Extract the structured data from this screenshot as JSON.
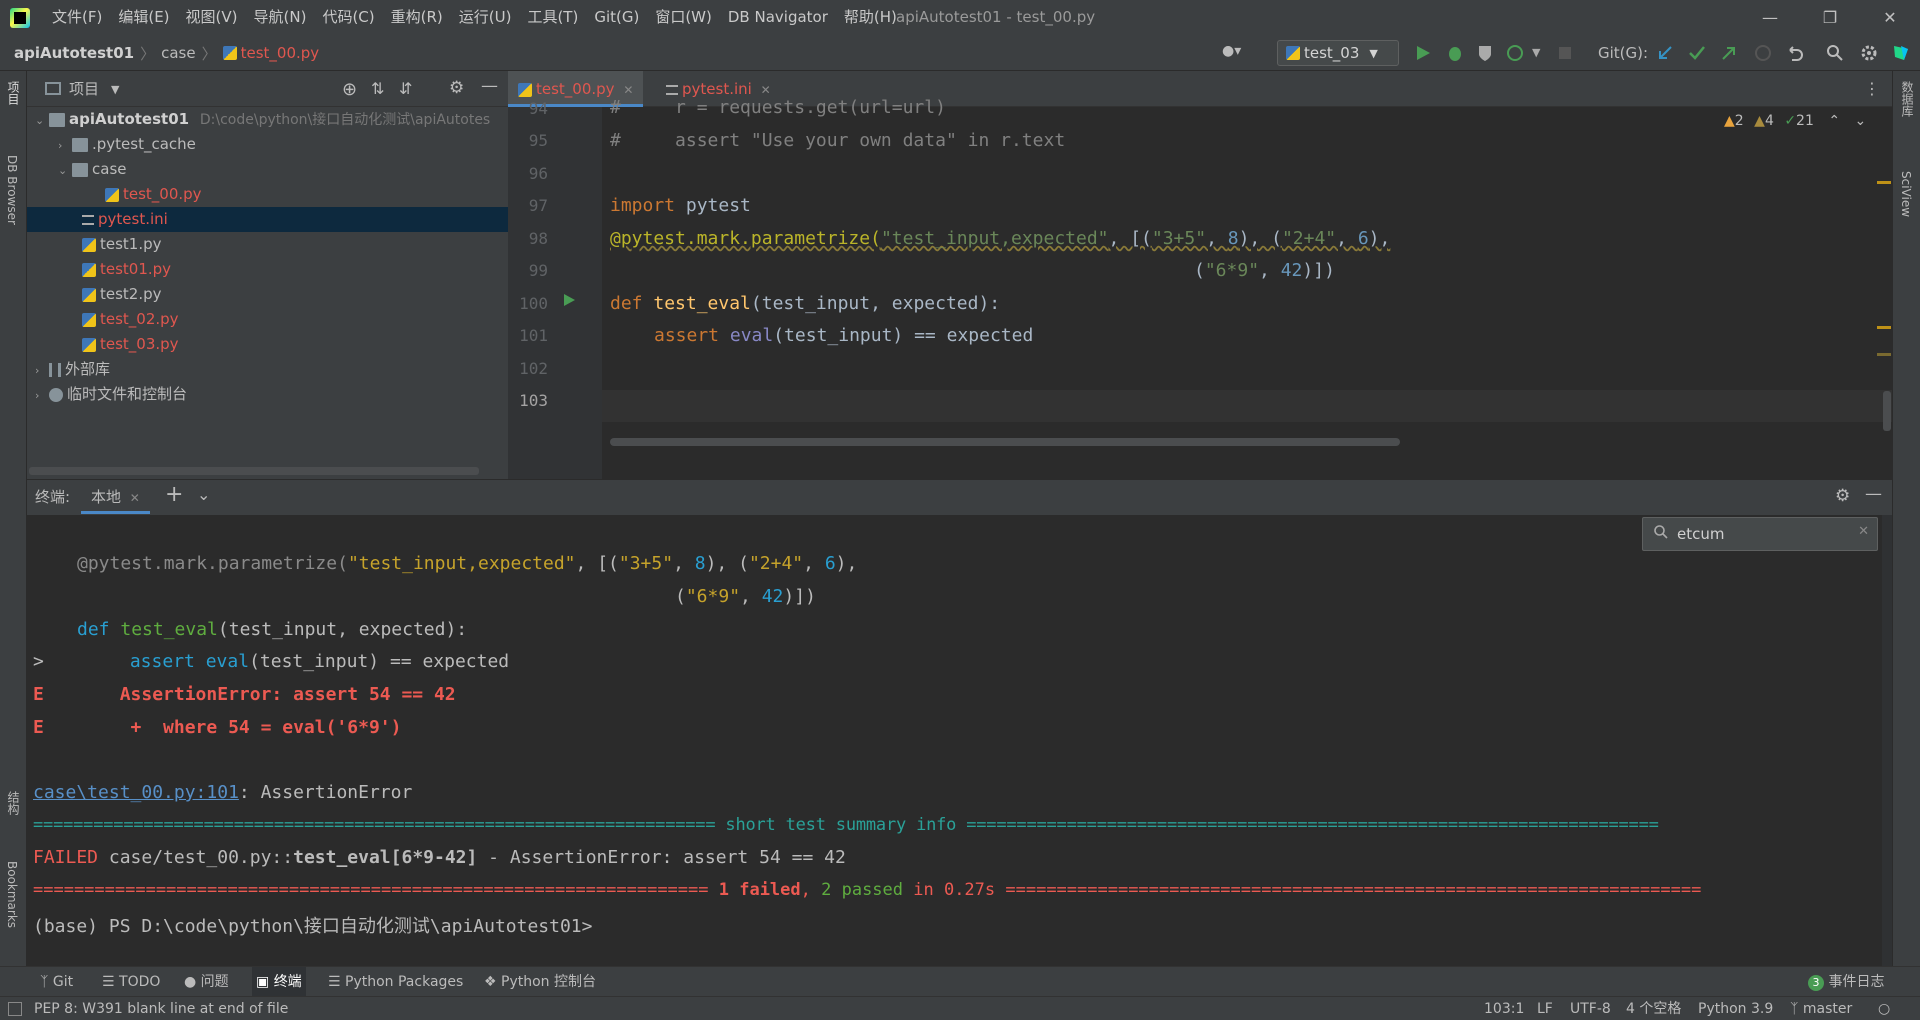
{
  "menubar": {
    "items": [
      "文件(F)",
      "编辑(E)",
      "视图(V)",
      "导航(N)",
      "代码(C)",
      "重构(R)",
      "运行(U)",
      "工具(T)",
      "Git(G)",
      "窗口(W)",
      "DB Navigator",
      "帮助(H)"
    ],
    "title": "apiAutotest01 - test_00.py"
  },
  "navbar": {
    "crumbs": [
      "apiAutotest01",
      "case",
      "test_00.py"
    ],
    "run_config": "test_03",
    "git_label": "Git(G):"
  },
  "leftstrip": {
    "project": "项目",
    "db_browser": "DB Browser",
    "structure": "结构",
    "bookmarks": "Bookmarks"
  },
  "rightstrip": {
    "database": "数据库",
    "sciview": "SciView"
  },
  "project": {
    "header": "项目",
    "root": "apiAutotest01",
    "root_path": "D:\\code\\python\\接口自动化测试\\apiAutotes",
    "tree": {
      "pytest_cache": ".pytest_cache",
      "case": "case",
      "test_00": "test_00.py",
      "pytest_ini": "pytest.ini",
      "test1": "test1.py",
      "test01": "test01.py",
      "test2": "test2.py",
      "test_02": "test_02.py",
      "test_03": "test_03.py",
      "ext": "外部库",
      "scratch": "临时文件和控制台"
    }
  },
  "editor": {
    "tabs": [
      "test_00.py",
      "pytest.ini"
    ],
    "inspections": {
      "errors": "2",
      "warnings": "4",
      "ok": "21"
    },
    "line_numbers": [
      "94",
      "95",
      "96",
      "97",
      "98",
      "99",
      "100",
      "101",
      "102",
      "103"
    ],
    "lines": {
      "l94": "#     r = requests.get(url=url)",
      "l95": "#     assert \"Use your own data\" in r.text",
      "l97_kw": "import",
      "l97_rest": " pytest",
      "l98_dec": "@pytest.mark.parametrize(",
      "l98_s1": "\"test_input,expected\"",
      "l98_p1": ", [(",
      "l98_s2": "\"3+5\"",
      "l98_c1": ", ",
      "l98_n1": "8",
      "l98_p2": "), (",
      "l98_s3": "\"2+4\"",
      "l98_c2": ", ",
      "l98_n2": "6",
      "l98_p3": "),",
      "l99_p1": "(",
      "l99_s1": "\"6*9\"",
      "l99_c1": ", ",
      "l99_n1": "42",
      "l99_p2": ")])",
      "l100_kw": "def",
      "l100_fn": " test_eval",
      "l100_rest": "(test_input, expected):",
      "l101_kw": "assert",
      "l101_bi": " eval",
      "l101_rest": "(test_input) == expected"
    }
  },
  "terminal": {
    "header": "终端:",
    "tab": "本地",
    "search": "etcum",
    "t1_dec": "@pytest.mark.parametrize(",
    "t1_s1": "\"test_input,expected\"",
    "t1_p1": ", [(",
    "t1_s2": "\"3+5\"",
    "t1_c": ", ",
    "t1_n1": "8",
    "t1_p2": "), (",
    "t1_s3": "\"2+4\"",
    "t1_n2": "6",
    "t1_p3": "),",
    "t2_p": "(",
    "t2_s": "\"6*9\"",
    "t2_c": ", ",
    "t2_n": "42",
    "t2_e": ")])",
    "t3_kw": "def",
    "t3_fn": " test_eval",
    "t3_rest": "(test_input, expected):",
    "t4_gt": ">",
    "t4_kw": "assert",
    "t4_bi": " eval",
    "t4_rest": "(test_input) == expected",
    "t5": "E       AssertionError: assert 54 == 42",
    "t6": "E        +  where 54 = eval('6*9')",
    "t7_link": "case\\test_00.py:101",
    "t7_rest": ": AssertionError",
    "t8": "==================================================================== short test summary info =====================================================================",
    "t9_failed": "FAILED",
    "t9_mid": " case/test_00.py::",
    "t9_bold": "test_eval[6*9-42]",
    "t9_rest": " - AssertionError: assert 54 == 42",
    "t10_pre": "================================================================== ",
    "t10_failed": "1 failed",
    "t10_comma": ", ",
    "t10_passed": "2 passed",
    "t10_in": " in 0.27s",
    "t10_post": " ====================================================================",
    "prompt": "(base) PS D:\\code\\python\\接口自动化测试\\apiAutotest01>"
  },
  "toolwindows": {
    "git": "Git",
    "todo": "TODO",
    "problems": "问题",
    "terminal": "终端",
    "packages": "Python Packages",
    "console": "Python 控制台",
    "events_count": "3",
    "events": "事件日志"
  },
  "status": {
    "message": "PEP 8: W391 blank line at end of file",
    "position": "103:1",
    "line_sep": "LF",
    "encoding": "UTF-8",
    "indent": "4 个空格",
    "interpreter": "Python 3.9",
    "branch": "master"
  }
}
